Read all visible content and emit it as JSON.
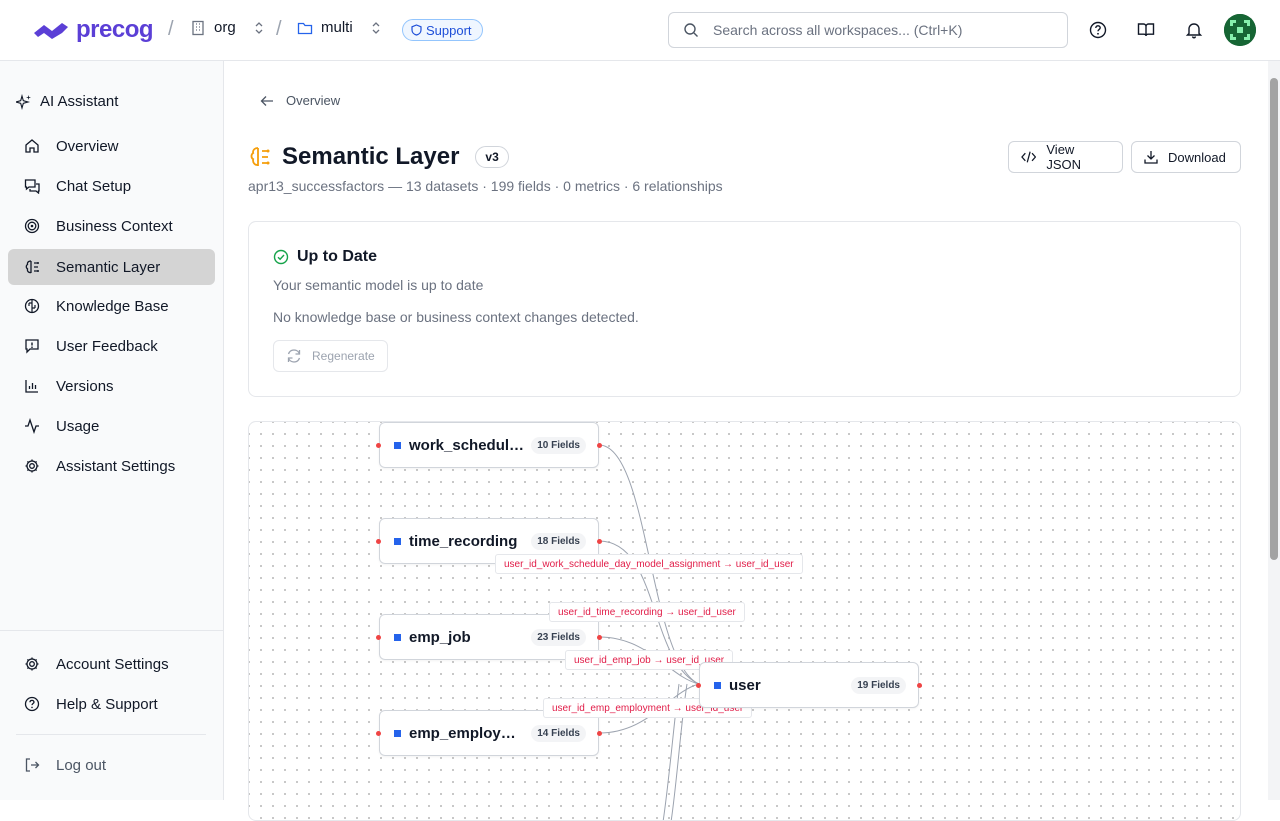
{
  "header": {
    "brand": "precog",
    "breadcrumbs": [
      {
        "label": "org",
        "icon": "building-icon"
      },
      {
        "label": "multi",
        "icon": "folder-icon"
      }
    ],
    "separator": "/",
    "support_label": "Support",
    "search": {
      "placeholder": "Search across all workspaces... (Ctrl+K)"
    }
  },
  "sidebar": {
    "title": "AI Assistant",
    "items": [
      {
        "label": "Overview",
        "icon": "home-icon"
      },
      {
        "label": "Chat Setup",
        "icon": "chat-icon"
      },
      {
        "label": "Business Context",
        "icon": "target-icon"
      },
      {
        "label": "Semantic Layer",
        "icon": "brain-icon",
        "active": true
      },
      {
        "label": "Knowledge Base",
        "icon": "brain-circuit-icon"
      },
      {
        "label": "User Feedback",
        "icon": "feedback-icon"
      },
      {
        "label": "Versions",
        "icon": "bar-chart-icon"
      },
      {
        "label": "Usage",
        "icon": "activity-icon"
      },
      {
        "label": "Assistant Settings",
        "icon": "gear-icon"
      }
    ],
    "bottom": [
      {
        "label": "Account Settings",
        "icon": "gear-icon"
      },
      {
        "label": "Help & Support",
        "icon": "help-icon"
      }
    ],
    "logout": "Log out"
  },
  "page": {
    "back_label": "Overview",
    "title": "Semantic Layer",
    "version": "v3",
    "subtitle": "apr13_successfactors — 13 datasets · 199 fields · 0 metrics · 6 relationships",
    "view_json": "View JSON",
    "download": "Download"
  },
  "status": {
    "title": "Up to Date",
    "line1": "Your semantic model is up to date",
    "line2": "No knowledge base or business context changes detected.",
    "regenerate": "Regenerate"
  },
  "graph": {
    "nodes": [
      {
        "name": "work_schedule...",
        "fields": "10 Fields"
      },
      {
        "name": "time_recording",
        "fields": "18 Fields"
      },
      {
        "name": "emp_job",
        "fields": "23 Fields"
      },
      {
        "name": "emp_employme...",
        "fields": "14 Fields"
      },
      {
        "name": "user",
        "fields": "19 Fields"
      }
    ],
    "edges": [
      "user_id_work_schedule_day_model_assignment → user_id_user",
      "user_id_time_recording → user_id_user",
      "user_id_emp_job → user_id_user",
      "user_id_emp_employment → user_id_user"
    ]
  },
  "colors": {
    "brand": "#5b3fd6",
    "accent": "#2563eb",
    "edge_label": "#e11d48",
    "success": "#16a34a",
    "title_icon": "#f59e0b"
  }
}
